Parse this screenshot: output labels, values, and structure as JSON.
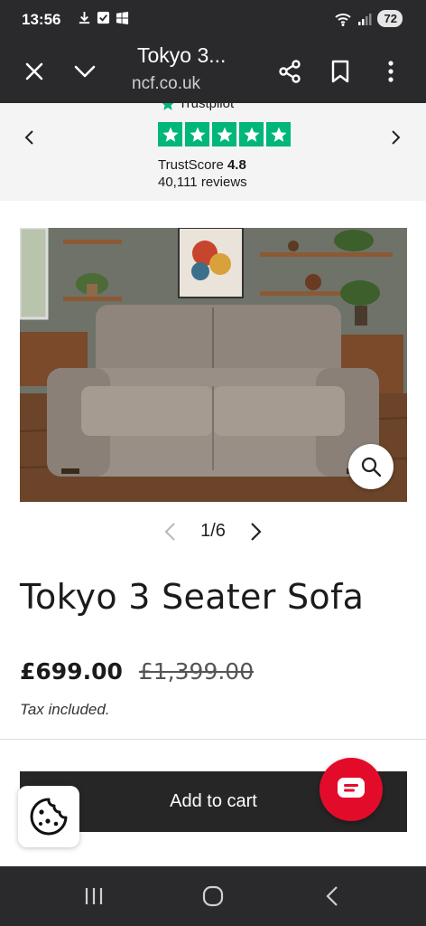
{
  "status_bar": {
    "time": "13:56",
    "battery": "72",
    "icons": [
      "download-icon",
      "checkbox-icon",
      "windows-icon",
      "wifi-icon",
      "signal-icon",
      "battery-icon"
    ]
  },
  "browser": {
    "title": "Tokyo 3...",
    "url": "ncf.co.uk",
    "icons": [
      "close-icon",
      "chevron-down-icon",
      "share-icon",
      "bookmark-icon",
      "more-vert-icon"
    ]
  },
  "trustpilot": {
    "brand": "Trustpilot",
    "score_label": "TrustScore",
    "score_value": "4.8",
    "reviews": "40,111 reviews",
    "star_count": 5,
    "color": "#00b67a"
  },
  "gallery": {
    "counter": "1/6"
  },
  "product": {
    "title": "Tokyo 3 Seater Sofa",
    "price": "£699.00",
    "price_old": "£1,399.00",
    "tax_note": "Tax included."
  },
  "actions": {
    "add_to_cart": "Add to cart"
  },
  "colors": {
    "chat_button": "#e30b2a",
    "cart_button": "#262626",
    "bar_background": "#2a2a2c"
  }
}
